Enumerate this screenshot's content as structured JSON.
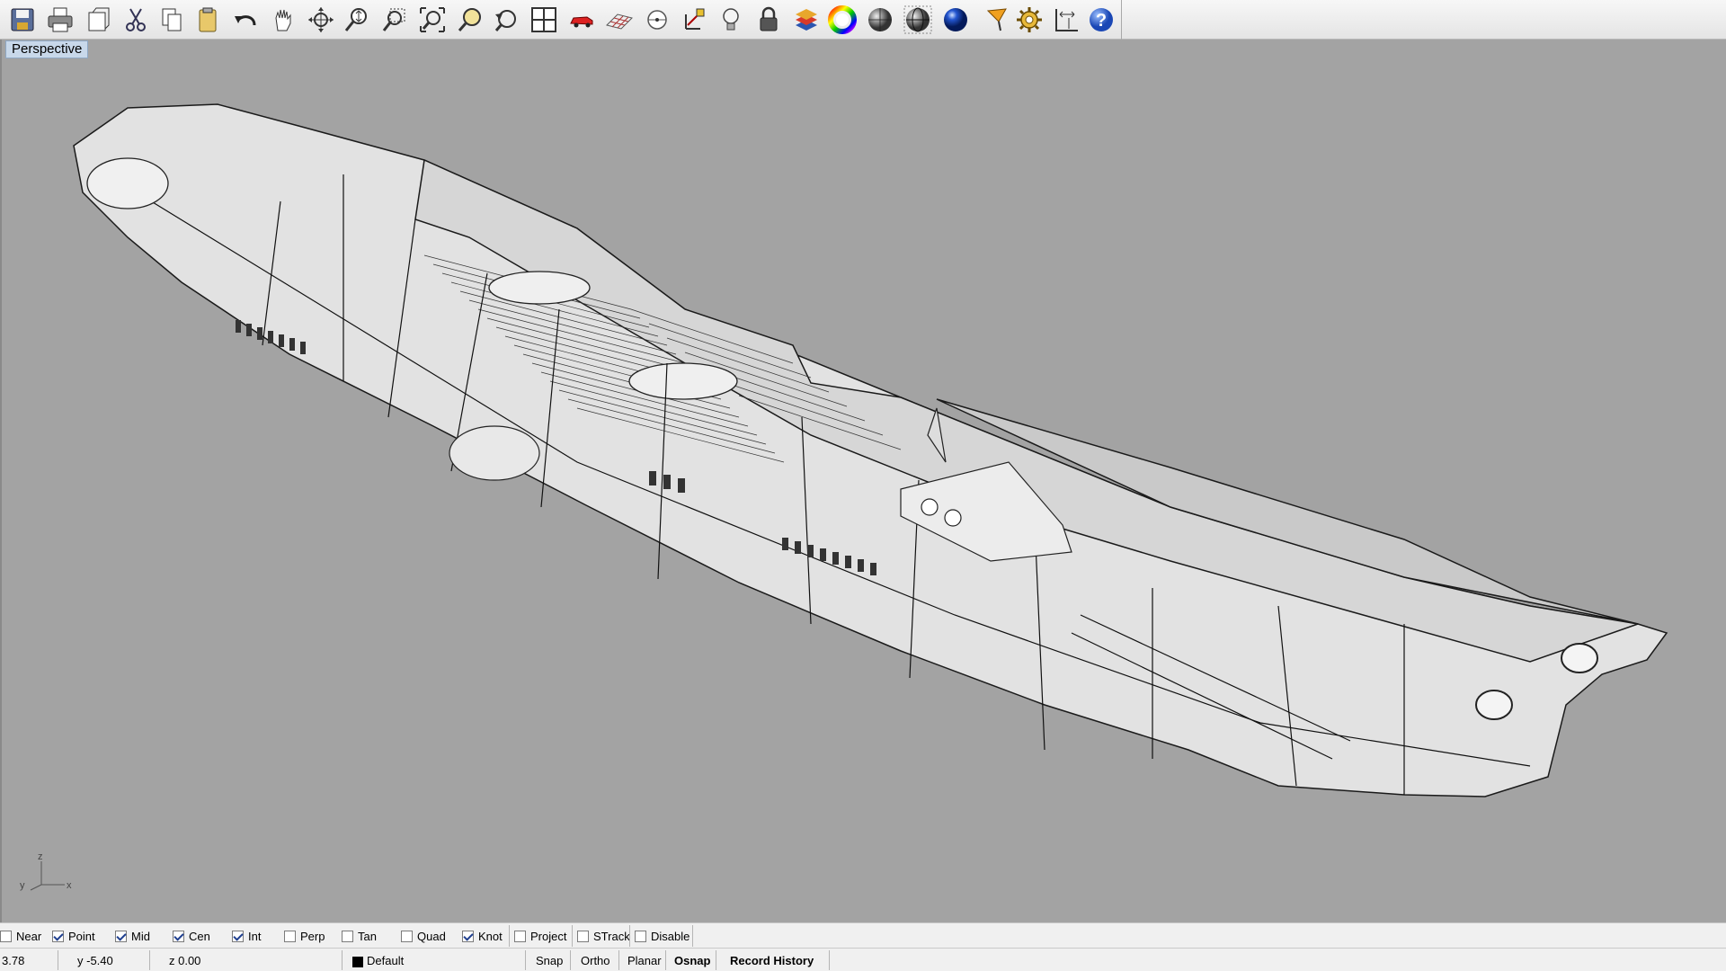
{
  "toolbar": {
    "buttons": [
      {
        "name": "save-icon"
      },
      {
        "name": "print-icon"
      },
      {
        "name": "cut-plane-icon"
      },
      {
        "name": "cut-icon"
      },
      {
        "name": "copy-icon"
      },
      {
        "name": "paste-icon"
      },
      {
        "name": "undo-icon"
      },
      {
        "name": "pan-hand-icon"
      },
      {
        "name": "rotate-view-icon"
      },
      {
        "name": "zoom-icon"
      },
      {
        "name": "zoom-window-icon"
      },
      {
        "name": "zoom-extents-icon"
      },
      {
        "name": "zoom-selected-icon"
      },
      {
        "name": "undo-view-icon"
      },
      {
        "name": "four-viewports-icon"
      },
      {
        "name": "car-icon"
      },
      {
        "name": "grid-plane-icon"
      },
      {
        "name": "point-icon"
      },
      {
        "name": "cplane-icon"
      },
      {
        "name": "light-bulb-icon"
      },
      {
        "name": "lock-icon"
      },
      {
        "name": "layer-icon"
      },
      {
        "name": "color-wheel-icon"
      },
      {
        "name": "shaded-sphere-icon"
      },
      {
        "name": "wireframe-sphere-icon"
      },
      {
        "name": "render-sphere-icon"
      },
      {
        "name": "select-filter-icon"
      },
      {
        "name": "settings-gear-icon"
      },
      {
        "name": "dimension-icon"
      },
      {
        "name": "help-icon"
      }
    ]
  },
  "viewport": {
    "title": "Perspective",
    "axis": {
      "z": "z",
      "y": "y",
      "x": "x"
    },
    "background": "#a3a3a3"
  },
  "osnap": [
    {
      "label": "Near",
      "checked": false
    },
    {
      "label": "Point",
      "checked": true
    },
    {
      "label": "Mid",
      "checked": true
    },
    {
      "label": "Cen",
      "checked": true
    },
    {
      "label": "Int",
      "checked": true
    },
    {
      "label": "Perp",
      "checked": false
    },
    {
      "label": "Tan",
      "checked": false
    },
    {
      "label": "Quad",
      "checked": false
    },
    {
      "label": "Knot",
      "checked": true
    },
    {
      "label": "Project",
      "checked": false
    },
    {
      "label": "STrack",
      "checked": false
    },
    {
      "label": "Disable",
      "checked": false
    }
  ],
  "status": {
    "x": "3.78",
    "y": "y -5.40",
    "z": "z 0.00",
    "layer": "Default",
    "snap": "Snap",
    "ortho": "Ortho",
    "planar": "Planar",
    "osnap": "Osnap",
    "record_history": "Record History"
  }
}
